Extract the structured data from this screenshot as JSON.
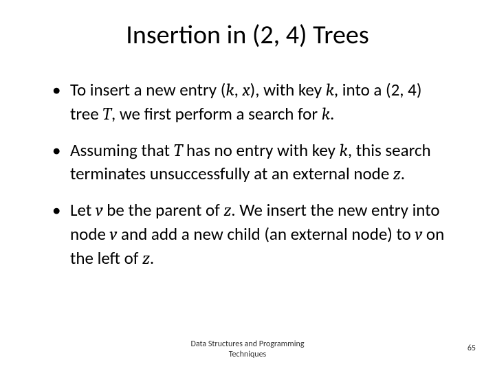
{
  "title": "Insertion in (2, 4) Trees",
  "bullets": {
    "b1": {
      "t1": "To insert a new entry ",
      "pair_open": "(",
      "k": "k",
      "comma": ", ",
      "x": "x",
      "pair_close": ")",
      "t2": ", with key ",
      "k2": "k",
      "t3": ", into a (2, 4) tree ",
      "T": "T",
      "t4": ", we first perform a search for ",
      "k3": "k",
      "t5": "."
    },
    "b2": {
      "t1": "Assuming that ",
      "T": "T",
      "t2": " has no entry with key ",
      "k": "k",
      "t3": ", this search terminates unsuccessfully at an external node ",
      "z": "z",
      "t4": "."
    },
    "b3": {
      "t1": "Let ",
      "v": "v",
      "t2": " be the parent of ",
      "z": "z",
      "t3": ". We insert the new entry into node ",
      "v2": "v",
      "t4": " and add a new child (an external node) to ",
      "v3": "v",
      "t5": " on the left of ",
      "z2": "z",
      "t6": "."
    }
  },
  "footer": {
    "line1": "Data Structures and Programming",
    "line2": "Techniques",
    "page": "65"
  }
}
